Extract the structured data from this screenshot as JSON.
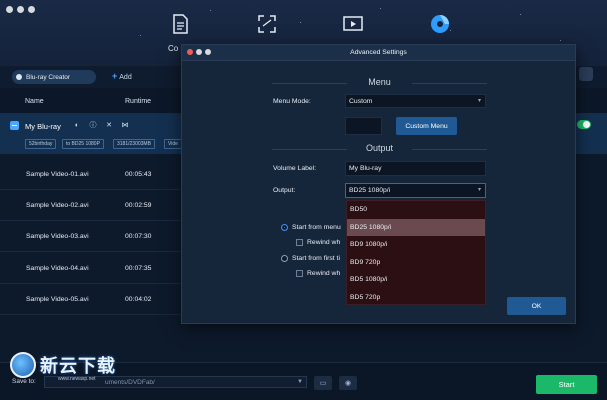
{
  "app": {
    "partial_nav_label": "Co"
  },
  "toolbar": {
    "creator_label": "Blu-ray Creator",
    "add_label": "Add"
  },
  "columns": {
    "name": "Name",
    "runtime": "Runtime"
  },
  "project": {
    "name": "My Blu-ray",
    "tags": [
      "52birthday",
      "to BD25 1080P",
      "3181/23003MB",
      "Vide"
    ]
  },
  "files": [
    {
      "name": "Sample Video-01.avi",
      "runtime": "00:05:43"
    },
    {
      "name": "Sample Video-02.avi",
      "runtime": "00:02:59"
    },
    {
      "name": "Sample Video-03.avi",
      "runtime": "00:07:30"
    },
    {
      "name": "Sample Video-04.avi",
      "runtime": "00:07:35"
    },
    {
      "name": "Sample Video-05.avi",
      "runtime": "00:04:02"
    }
  ],
  "bottom": {
    "save_to_label": "Save to:",
    "path_value": "uments/DVDFab/",
    "start_label": "Start"
  },
  "watermark": {
    "text": "新云下载",
    "url": "www.newasp.net"
  },
  "dialog": {
    "title": "Advanced Settings",
    "menu_section": "Menu",
    "menu_mode_label": "Menu Mode:",
    "menu_mode_value": "Custom",
    "custom_menu_button": "Custom Menu",
    "output_section": "Output",
    "volume_label_label": "Volume Label:",
    "volume_label_value": "My Blu-ray",
    "output_label": "Output:",
    "output_value": "BD25 1080p/i",
    "start_menu_option": "Start from menu",
    "rewind_option_1": "Rewind wh",
    "start_title_option": "Start from first ti",
    "rewind_option_2": "Rewind wh",
    "ok_label": "OK",
    "output_options": [
      "BD50",
      "BD25 1080p/i",
      "BD9 1080p/i",
      "BD9 720p",
      "BD5 1080p/i",
      "BD5 720p"
    ],
    "output_selected_index": 1
  },
  "colors": {
    "accent_blue": "#1f5a94",
    "start_green": "#1cb86a",
    "dropdown_bg": "#2b0f12",
    "dropdown_selected": "#6a4a4e"
  }
}
